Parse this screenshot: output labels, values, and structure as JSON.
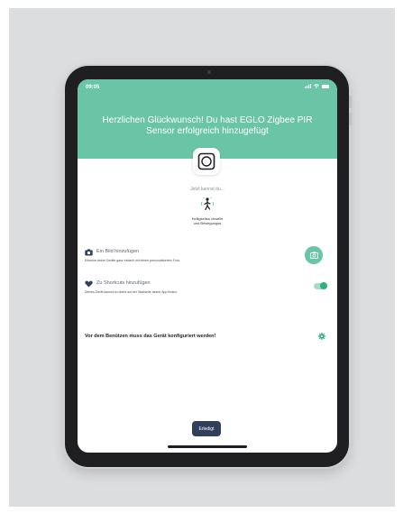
{
  "status_bar": {
    "time": "09:05",
    "signal": "…ᴵ",
    "wifi": "▿"
  },
  "header": {
    "title": "Herzlichen Glückwunsch! Du hast EGLO Zigbee PIR Sensor erfolgreich hinzugefügt"
  },
  "intro": {
    "subtitle": "Jetzt kannst du..."
  },
  "feature": {
    "label": "Helligkeitss chwelle und Bewegungss"
  },
  "actions": {
    "add_photo": {
      "title": "Ein Bild hinzufügen",
      "description": "Erkenne deine Geräte ganz einfach mit einem personalisierten Foto."
    },
    "add_shortcut": {
      "title": "Zu Shortcuts hinzufügen",
      "description": "Dieses Gerät kannst du direkt auf der Startseite deiner App finden.",
      "enabled": true
    }
  },
  "warning": {
    "text": "Vor dem Benützen muss das Gerät konfiguriert werden!"
  },
  "footer": {
    "done_label": "Erledigt"
  },
  "colors": {
    "accent": "#6ac5a6",
    "toggle_on": "#2fb07f",
    "button": "#2f3f5c"
  }
}
